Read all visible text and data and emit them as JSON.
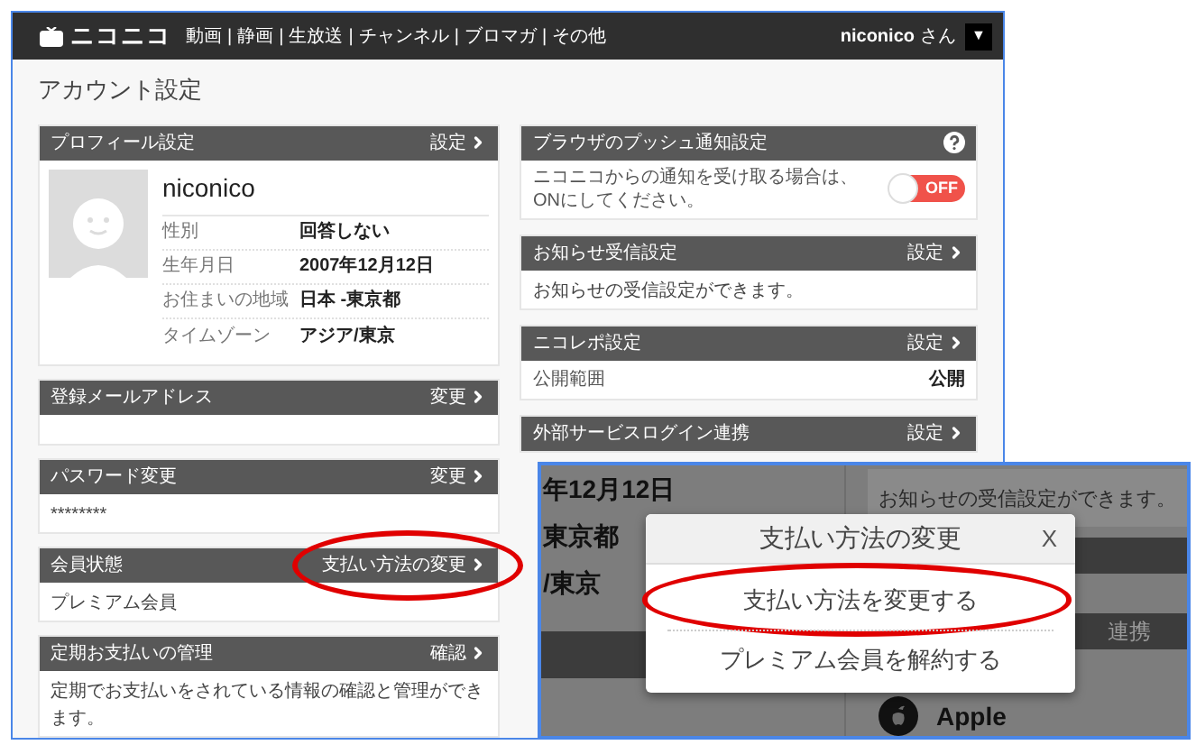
{
  "header": {
    "logo": "ニコニコ",
    "nav": [
      "動画",
      "静画",
      "生放送",
      "チャンネル",
      "ブロマガ",
      "その他"
    ],
    "nav_separator": "|",
    "user": "niconico",
    "user_suffix": "さん",
    "menu_glyph": "▼"
  },
  "page_title": "アカウント設定",
  "left_cards": [
    {
      "kind": "profile",
      "title": "プロフィール設定",
      "action": "設定",
      "highlighted": false,
      "name": "niconico",
      "fields": [
        {
          "label": "性別",
          "value": "回答しない"
        },
        {
          "label": "生年月日",
          "value": "2007年12月12日"
        },
        {
          "label": "お住まいの地域",
          "value": "日本 -東京都"
        },
        {
          "label": "タイムゾーン",
          "value": "アジア/東京"
        }
      ]
    },
    {
      "kind": "empty",
      "title": "登録メールアドレス",
      "action": "変更",
      "highlighted": false
    },
    {
      "kind": "text",
      "title": "パスワード変更",
      "action": "変更",
      "highlighted": false,
      "text": "********"
    },
    {
      "kind": "text",
      "title": "会員状態",
      "action": "支払い方法の変更",
      "highlighted": true,
      "text": "プレミアム会員"
    },
    {
      "kind": "text",
      "title": "定期お支払いの管理",
      "action": "確認",
      "highlighted": false,
      "text": "定期でお支払いをされている情報の確認と管理ができます。"
    }
  ],
  "right_cards": [
    {
      "kind": "push",
      "title": "ブラウザのプッシュ通知設定",
      "text": "ニコニコからの通知を受け取る場合は、ONにしてください。",
      "toggle": {
        "on": false,
        "label": "OFF"
      }
    },
    {
      "kind": "text",
      "title": "お知らせ受信設定",
      "action": "設定",
      "text": "お知らせの受信設定ができます。"
    },
    {
      "kind": "pair",
      "title": "ニコレポ設定",
      "action": "設定",
      "label": "公開範囲",
      "value": "公開"
    },
    {
      "kind": "header",
      "title": "外部サービスログイン連携",
      "action": "設定"
    }
  ],
  "inset": {
    "fragments": [
      "年12月12日",
      "東京都",
      "/東京"
    ],
    "notice_text": "お知らせの受信設定ができます。",
    "bar_text": "連携",
    "service": "Apple",
    "modal": {
      "title": "支払い方法の変更",
      "close": "X",
      "options": [
        {
          "label": "支払い方法を変更する",
          "highlighted": true
        },
        {
          "label": "プレミアム会員を解約する",
          "highlighted": false
        }
      ]
    }
  }
}
